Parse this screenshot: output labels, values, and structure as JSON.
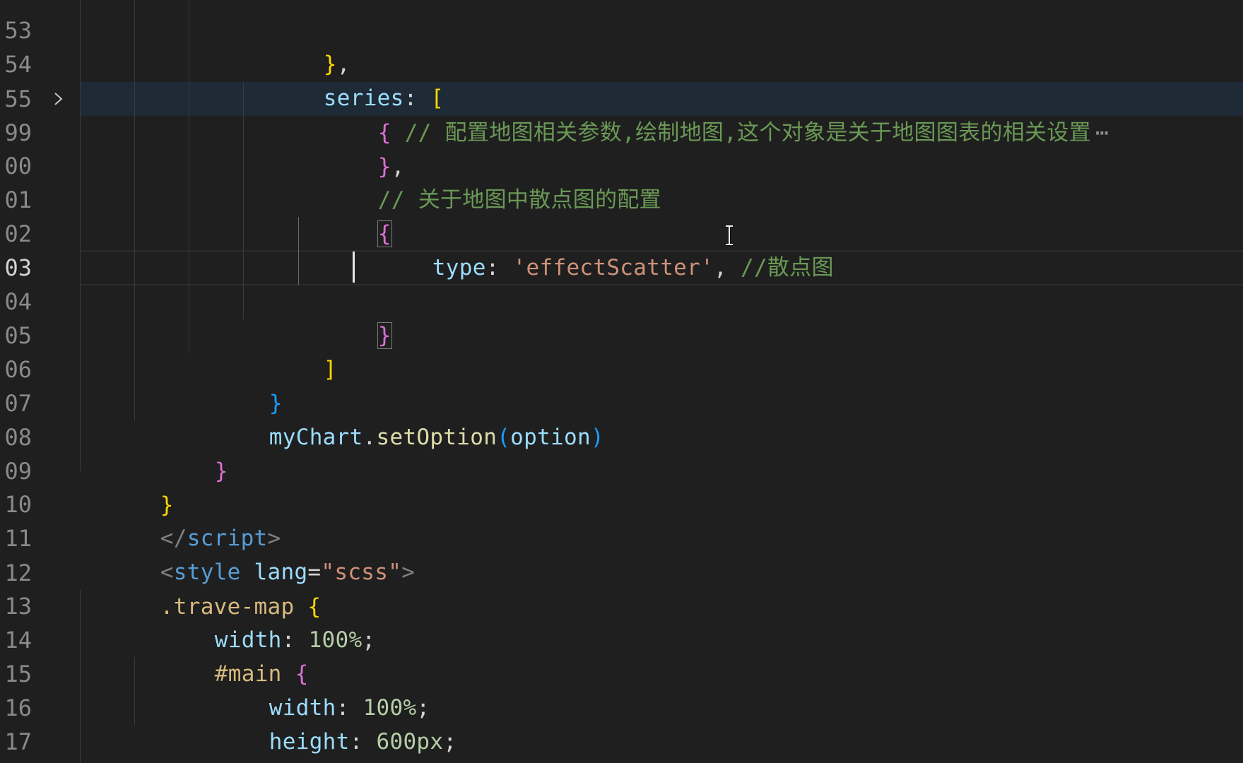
{
  "editor": {
    "line_numbers": [
      "53",
      "54",
      "55",
      "99",
      "00",
      "01",
      "02",
      "03",
      "04",
      "05",
      "06",
      "07",
      "08",
      "09",
      "10",
      "11",
      "12",
      "13",
      "14",
      "15",
      "16",
      "17"
    ],
    "active_line": "03",
    "folded_line": "55",
    "lines": {
      "l53": {
        "close": "}",
        "comma": ","
      },
      "l54": {
        "key": "series",
        "colon": ": ",
        "open": "["
      },
      "l55": {
        "open": "{",
        "comment": " // 配置地图相关参数,绘制地图,这个对象是关于地图图表的相关设置",
        "ellipsis": "⋯"
      },
      "l99": {
        "close": "}",
        "comma": ","
      },
      "l100": {
        "comment": "// 关于地图中散点图的配置"
      },
      "l101": {
        "open": "{"
      },
      "l102": {
        "key": "type",
        "colon": ": ",
        "value": "'effectScatter'",
        "comma": ", ",
        "comment": "//散点图"
      },
      "l104": {
        "close": "}"
      },
      "l105": {
        "close": "]"
      },
      "l106": {
        "close": "}"
      },
      "l107": {
        "obj": "myChart",
        "dot": ".",
        "method": "setOption",
        "paren_open": "(",
        "arg": "option",
        "paren_close": ")"
      },
      "l108": {
        "close": "}"
      },
      "l109": {
        "close": "}"
      },
      "l110": {
        "lt": "</",
        "tag": "script",
        "gt": ">"
      },
      "l111": {
        "lt": "<",
        "tag": "style",
        "attr": " lang",
        "eq": "=",
        "value": "\"scss\"",
        "gt": ">"
      },
      "l112": {
        "selector": ".trave-map",
        "space": " ",
        "open": "{"
      },
      "l113": {
        "prop": "width",
        "colon": ": ",
        "value": "100%",
        "semi": ";"
      },
      "l114": {
        "selector": "#main",
        "space": " ",
        "open": "{"
      },
      "l115": {
        "prop": "width",
        "colon": ": ",
        "value": "100%",
        "semi": ";"
      },
      "l116": {
        "prop": "height",
        "colon": ": ",
        "value": "600px",
        "semi": ";"
      },
      "l117": {
        "close": "}"
      }
    },
    "icons": {
      "fold": "chevron-right-icon",
      "cursor": "text-cursor-icon"
    }
  }
}
